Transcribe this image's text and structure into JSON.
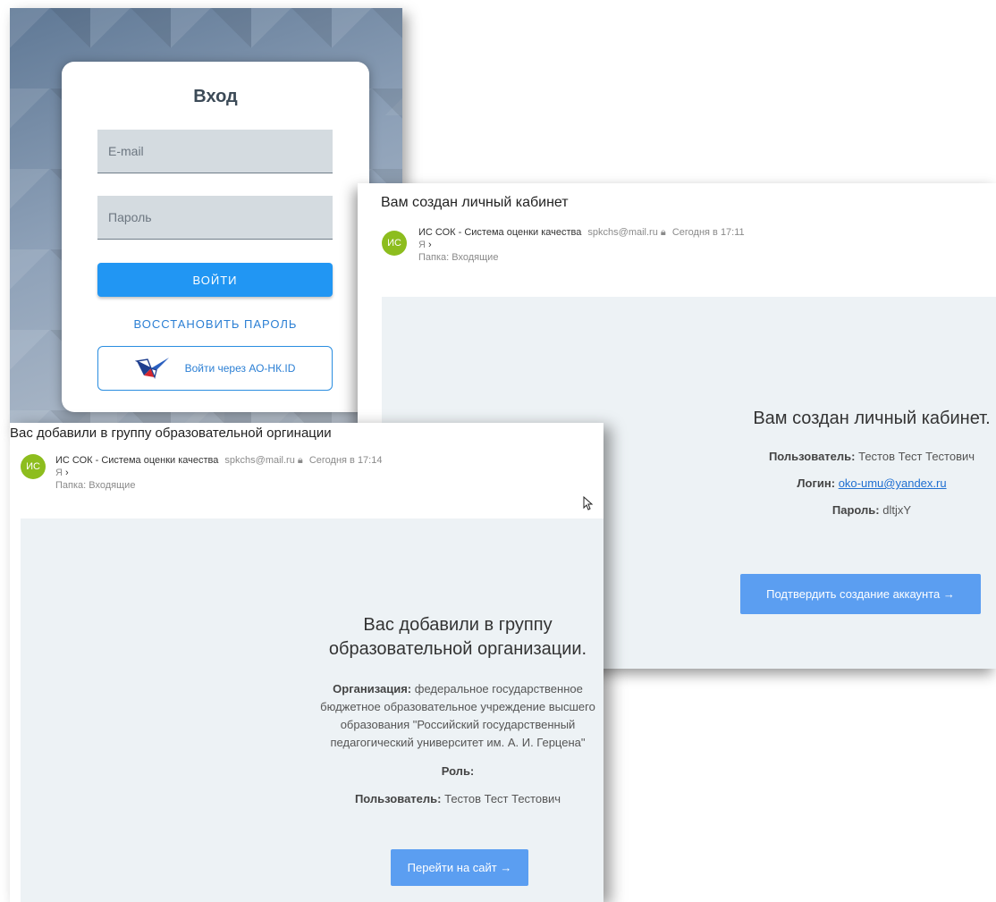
{
  "login": {
    "title": "Вход",
    "email_placeholder": "E-mail",
    "password_placeholder": "Пароль",
    "submit_label": "ВОЙТИ",
    "restore_label": "ВОССТАНОВИТЬ ПАРОЛЬ",
    "sso_label": "Войти через АО-НК.ID"
  },
  "email_account": {
    "subject": "Вам создан личный кабинет",
    "avatar": "ИС",
    "sender": "ИС СОК - Система оценки качества",
    "sender_address": "spkchs@mail.ru",
    "date": "Сегодня в 17:11",
    "recipient": "Я",
    "folder_label": "Папка:",
    "folder": "Входящие",
    "heading": "Вам создан личный кабинет.",
    "user_label": "Пользователь:",
    "user_value": "Тестов Тест Тестович",
    "login_label": "Логин:",
    "login_value": "oko-umu@yandex.ru",
    "password_label": "Пароль:",
    "password_value": "dltjxY",
    "confirm_button": "Подтвердить создание аккаунта →"
  },
  "email_group": {
    "subject": "Вас добавили в группу образовательной оргинации",
    "avatar": "ИС",
    "sender": "ИС СОК - Система оценки качества",
    "sender_address": "spkchs@mail.ru",
    "date": "Сегодня в 17:14",
    "recipient": "Я",
    "folder_label": "Папка:",
    "folder": "Входящие",
    "heading_line1": "Вас добавили в группу",
    "heading_line2": "образовательной организации.",
    "org_label": "Организация:",
    "org_line1": "федеральное государственное",
    "org_line2": "бюджетное образовательное учреждение высшего",
    "org_line3": "образования \"Российский государственный",
    "org_line4": "педагогический университет им. А. И. Герцена\"",
    "role_label": "Роль:",
    "user_label": "Пользователь:",
    "user_value": "Тестов Тест Тестович",
    "site_button": "Перейти на сайт →"
  },
  "icons": {
    "lock": "lock-icon",
    "chevron": "chevron-right-icon",
    "cursor": "mouse-cursor-icon",
    "sso_logo": "bird-logo-icon"
  }
}
